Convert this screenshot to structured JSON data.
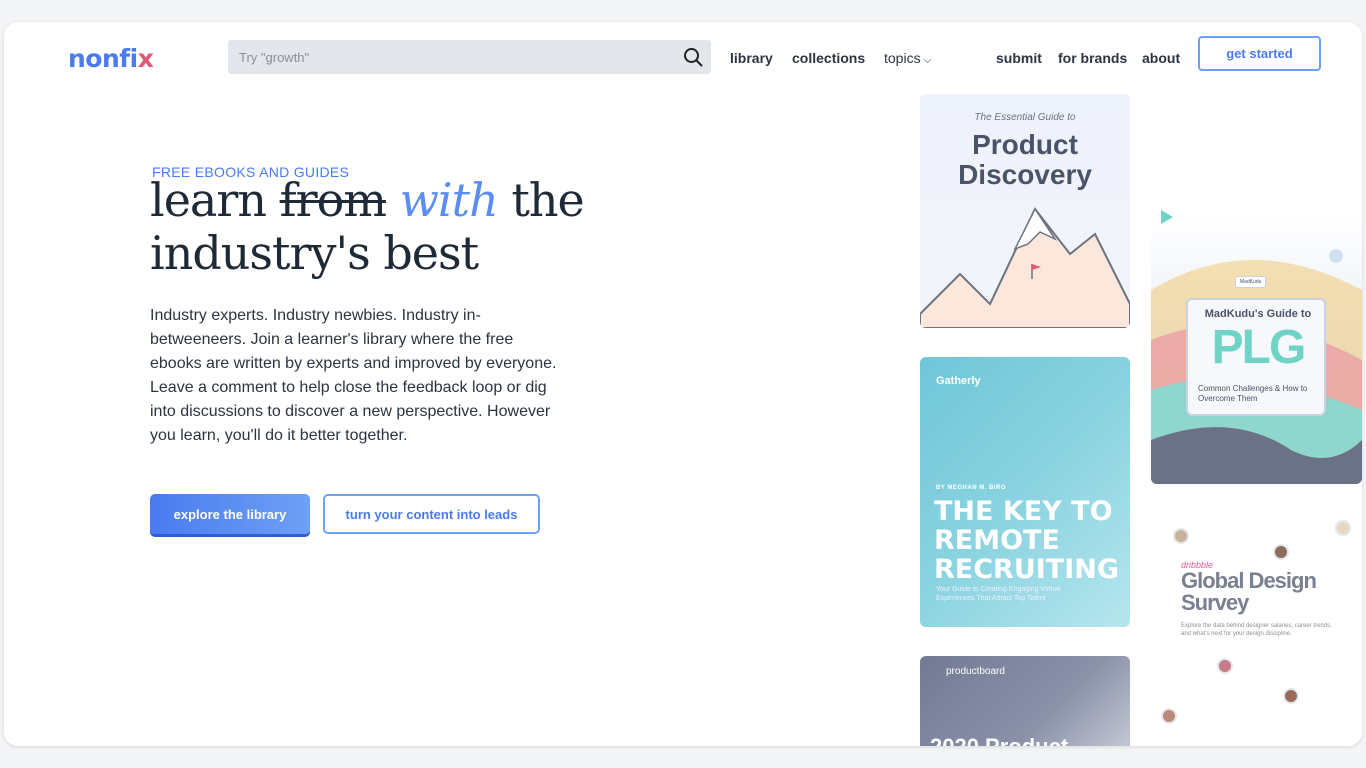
{
  "header": {
    "logo_main": "nonfi",
    "logo_x": "x",
    "search_placeholder": "Try \"growth\"",
    "nav": {
      "library": "library",
      "collections": "collections",
      "topics": "topics",
      "submit": "submit",
      "for_brands": "for brands",
      "about": "about"
    },
    "cta": "get started"
  },
  "hero": {
    "eyebrow": "FREE EBOOKS AND GUIDES",
    "headline_1": "learn",
    "headline_strike": "from",
    "headline_accent": "with",
    "headline_2": "the",
    "headline_3": "industry's best",
    "description": "Industry experts. Industry newbies. Industry in-betweeneers. Join a learner's library where the free ebooks are written by experts and improved by everyone. Leave a comment to help close the feedback loop or dig into discussions to discover a new perspective. However you learn, you'll do it better together.",
    "primary_button": "explore the library",
    "secondary_button": "turn your content into leads"
  },
  "books": {
    "product_discovery": {
      "subtitle": "The Essential Guide to",
      "title": "Product Discovery"
    },
    "remote_recruiting": {
      "brand": "Gatherly",
      "author": "BY MEGHAN M. BIRO",
      "title": "THE KEY TO REMOTE RECRUITING",
      "subtitle": "Your Guide to Creating Engaging Virtual Experiences That Attract Top Talent"
    },
    "productboard": {
      "brand": "productboard",
      "title": "2020 Product"
    },
    "plg": {
      "tag": "MadKudu",
      "heading": "MadKudu's Guide to",
      "title": "PLG",
      "subtitle": "Common Challenges & How to Overcome Them"
    },
    "design_survey": {
      "brand": "dribbble",
      "title": "Global Design Survey",
      "subtitle": "Explore the data behind designer salaries, career trends, and what's next for your design discipline."
    }
  },
  "colors": {
    "accent": "#4a7bf0",
    "logo_x": "#e05a73",
    "heading": "#1f2a37"
  }
}
